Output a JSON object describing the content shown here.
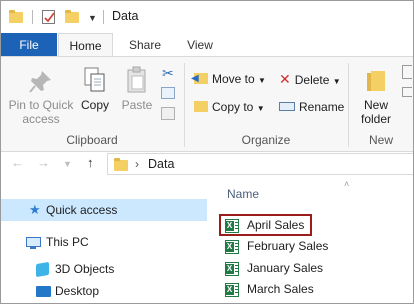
{
  "window": {
    "title": "Data"
  },
  "tabs": [
    {
      "label": "File"
    },
    {
      "label": "Home"
    },
    {
      "label": "Share"
    },
    {
      "label": "View"
    }
  ],
  "ribbon": {
    "clipboard": {
      "pin_label": "Pin to Quick access",
      "pin_line1": "Pin to Quick",
      "pin_line2": "access",
      "copy_label": "Copy",
      "paste_label": "Paste",
      "group_label": "Clipboard"
    },
    "organize": {
      "move_to": "Move to",
      "copy_to": "Copy to",
      "delete": "Delete",
      "rename": "Rename",
      "group_label": "Organize"
    },
    "new": {
      "new_folder_line1": "New",
      "new_folder_line2": "folder",
      "group_label": "New"
    }
  },
  "address": {
    "path": "Data"
  },
  "nav_pane": {
    "items": [
      {
        "label": "Quick access",
        "selected": true
      },
      {
        "label": "This PC"
      },
      {
        "label": "3D Objects"
      },
      {
        "label": "Desktop"
      }
    ]
  },
  "file_list": {
    "column_name": "Name",
    "files": [
      {
        "name": "April Sales",
        "selected": true
      },
      {
        "name": "February Sales"
      },
      {
        "name": "January Sales"
      },
      {
        "name": "March Sales"
      }
    ]
  },
  "colors": {
    "file_tab": "#1c62b6",
    "selection": "#cce8ff",
    "highlight_border": "#9b1c1c",
    "excel_green": "#1f7a45",
    "folder_yellow": "#f3cf64"
  }
}
